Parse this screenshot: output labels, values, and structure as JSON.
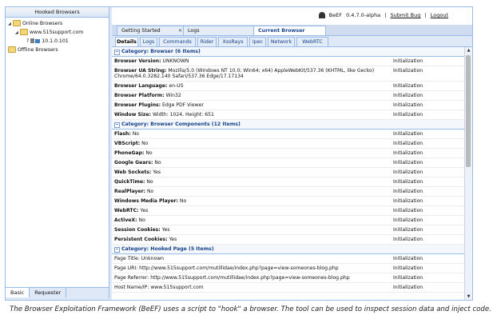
{
  "topbar": {
    "app": "BeEF",
    "version": "0.4.7.0-alpha",
    "sep": "|",
    "submit_bug": "Submit  Bug",
    "logout": "Logout"
  },
  "left_panel": {
    "header": "Hooked Browsers",
    "tree": [
      {
        "label": "Online Browsers",
        "level": 0,
        "arrow": "◢"
      },
      {
        "label": "www.515support.com",
        "level": 1,
        "arrow": "◢"
      },
      {
        "label": "10.1.0.101",
        "level": 2,
        "prefix": "?"
      },
      {
        "label": "Offline Browsers",
        "level": 0
      }
    ],
    "bottom_tabs": [
      "Basic",
      "Requester"
    ]
  },
  "main_tabs": [
    {
      "label": "Getting Started",
      "closable": true
    },
    {
      "label": "Logs",
      "closable": false
    },
    {
      "label": "Current Browser",
      "closable": false,
      "active": true
    }
  ],
  "sub_tabs": [
    "Details",
    "Logs",
    "Commands",
    "Rider",
    "XssRays",
    "Ipec",
    "Network",
    "WebRTC"
  ],
  "categories": [
    {
      "title": "Category: Browser (6 Items)",
      "rows": [
        {
          "key": "Browser Version:",
          "value": "UNKNOWN",
          "source": "Initialization"
        },
        {
          "key": "Browser UA String:",
          "value": "Mozilla/5.0 (Windows NT 10.0; Win64; x64) AppleWebKit/537.36 (KHTML, like Gecko) Chrome/64.0.3282.140 Safari/537.36 Edge/17.17134",
          "source": "Initialization"
        },
        {
          "key": "Browser Language:",
          "value": "en-US",
          "source": "Initialization"
        },
        {
          "key": "Browser Platform:",
          "value": "Win32",
          "source": "Initialization"
        },
        {
          "key": "Browser Plugins:",
          "value": "Edge PDF Viewer",
          "source": "Initialization"
        },
        {
          "key": "Window Size:",
          "value": "Width: 1024, Height: 651",
          "source": "Initialization"
        }
      ]
    },
    {
      "title": "Category: Browser Components (12 Items)",
      "rows": [
        {
          "key": "Flash:",
          "value": "No",
          "source": "Initialization"
        },
        {
          "key": "VBScript:",
          "value": "No",
          "source": "Initialization"
        },
        {
          "key": "PhoneGap:",
          "value": "No",
          "source": "Initialization"
        },
        {
          "key": "Google Gears:",
          "value": "No",
          "source": "Initialization"
        },
        {
          "key": "Web Sockets:",
          "value": "Yes",
          "source": "Initialization"
        },
        {
          "key": "QuickTime:",
          "value": "No",
          "source": "Initialization"
        },
        {
          "key": "RealPlayer:",
          "value": "No",
          "source": "Initialization"
        },
        {
          "key": "Windows Media Player:",
          "value": "No",
          "source": "Initialization"
        },
        {
          "key": "WebRTC:",
          "value": "Yes",
          "source": "Initialization"
        },
        {
          "key": "ActiveX:",
          "value": "No",
          "source": "Initialization"
        },
        {
          "key": "Session Cookies:",
          "value": "Yes",
          "source": "Initialization"
        },
        {
          "key": "Persistent Cookies:",
          "value": "Yes",
          "source": "Initialization"
        }
      ]
    },
    {
      "title": "Category: Hooked Page (5 Items)",
      "rows": [
        {
          "key": "Page Title:",
          "value": "Unknown",
          "source": "Initialization",
          "plain": true
        },
        {
          "key": "Page URI:",
          "value": "http://www.515support.com/mutillidae/index.php?page=view-someones-blog.php",
          "source": "Initialization",
          "plain": true
        },
        {
          "key": "Page Referrer:",
          "value": "http://www.515support.com/mutillidae/index.php?page=view-someones-blog.php",
          "source": "Initialization",
          "plain": true
        },
        {
          "key": "Host Name/IP:",
          "value": "www.515support.com",
          "source": "Initialization",
          "plain": true
        }
      ]
    }
  ],
  "caption": "The Browser Exploitation Framework (BeEF) uses a script to \"hook\" a browser. The tool can be used to inspect session data and inject code."
}
